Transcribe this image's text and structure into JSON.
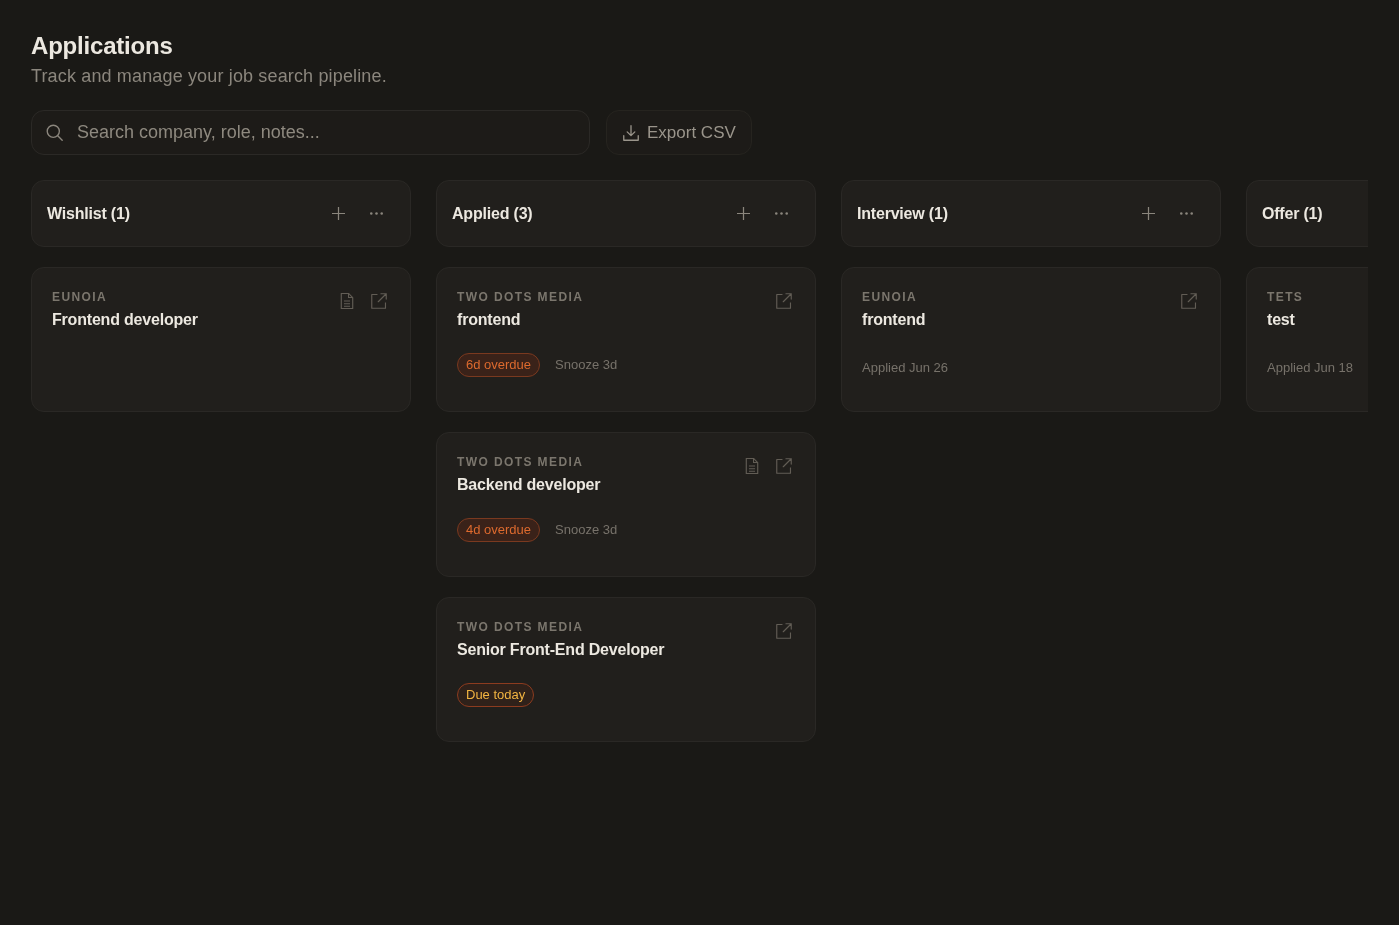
{
  "header": {
    "title": "Applications",
    "subtitle": "Track and manage your job search pipeline."
  },
  "search": {
    "placeholder": "Search company, role, notes..."
  },
  "export_button": {
    "label": "Export CSV"
  },
  "columns": [
    {
      "title": "Wishlist (1)",
      "actions_visible": true,
      "cards": [
        {
          "company": "EUNOIA",
          "role": "Frontend developer",
          "has_document": true,
          "has_link": true
        }
      ]
    },
    {
      "title": "Applied (3)",
      "actions_visible": true,
      "cards": [
        {
          "company": "TWO DOTS MEDIA",
          "role": "frontend",
          "has_document": false,
          "has_link": true,
          "due_badge": {
            "kind": "overdue",
            "label": "6d overdue"
          },
          "snooze": "Snooze 3d"
        },
        {
          "company": "TWO DOTS MEDIA",
          "role": "Backend developer",
          "has_document": true,
          "has_link": true,
          "due_badge": {
            "kind": "overdue",
            "label": "4d overdue"
          },
          "snooze": "Snooze 3d"
        },
        {
          "company": "TWO DOTS MEDIA",
          "role": "Senior Front-End Developer",
          "has_document": false,
          "has_link": true,
          "due_badge": {
            "kind": "due_today",
            "label": "Due today"
          }
        }
      ]
    },
    {
      "title": "Interview (1)",
      "actions_visible": true,
      "cards": [
        {
          "company": "EUNOIA",
          "role": "frontend",
          "has_document": false,
          "has_link": true,
          "applied": "Applied Jun 26"
        }
      ]
    },
    {
      "title": "Offer (1)",
      "actions_visible": false,
      "cards": [
        {
          "company": "TETS",
          "role": "test",
          "has_document": false,
          "has_link": false,
          "applied": "Applied Jun 18"
        }
      ]
    }
  ]
}
